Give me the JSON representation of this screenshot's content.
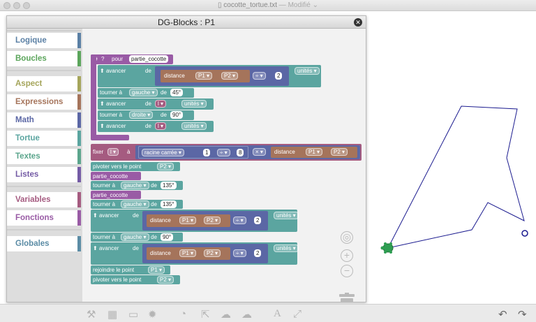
{
  "window": {
    "title": "cocotte_tortue.txt",
    "status": "— Modifié ⌄"
  },
  "panel": {
    "title": "DG-Blocks : P1",
    "close_icon": "✕"
  },
  "categories": [
    {
      "label": "Logique",
      "color": "#5b80a5",
      "bar": "#5b80a5"
    },
    {
      "label": "Boucles",
      "color": "#5ba55b",
      "bar": "#5ba55b"
    },
    {
      "label": "Aspect",
      "color": "#a5a55b",
      "bar": "#a5a55b"
    },
    {
      "label": "Expressions",
      "color": "#a5745b",
      "bar": "#a5745b"
    },
    {
      "label": "Math",
      "color": "#5b67a5",
      "bar": "#5b67a5"
    },
    {
      "label": "Tortue",
      "color": "#5ba5a0",
      "bar": "#5ba5a0"
    },
    {
      "label": "Textes",
      "color": "#5ba58c",
      "bar": "#5ba58c"
    },
    {
      "label": "Listes",
      "color": "#745ba5",
      "bar": "#745ba5"
    },
    {
      "label": "Variables",
      "color": "#a55b80",
      "bar": "#a55b80"
    },
    {
      "label": "Fonctions",
      "color": "#995ba5",
      "bar": "#995ba5"
    },
    {
      "label": "Globales",
      "color": "#5b8ca5",
      "bar": "#5b8ca5"
    }
  ],
  "blocks": {
    "fn": {
      "pour": "pour",
      "name": "partie_cocotte"
    },
    "avancer": "avancer",
    "de": "de",
    "unites": "unités",
    "distance": "distance",
    "p1": "P1",
    "p2": "P2",
    "div": "÷",
    "two": "2",
    "tourner": "tourner à",
    "gauche": "gauche",
    "droite": "droite",
    "a45": "45°",
    "a90": "90°",
    "a135": "135°",
    "l": "l",
    "fixer": "fixer",
    "a": "à",
    "racine": "racine carrée",
    "one": "1",
    "eight": "8",
    "times": "×",
    "pivoter": "pivoter vers le point",
    "call": "partie_cocotte",
    "rejoindre": "rejoindre le point"
  },
  "bottom_icons": [
    "tools-icon",
    "calculator-icon",
    "window-icon",
    "gear-icon",
    "timer-icon",
    "export-icon",
    "cloud-download-icon",
    "cloud-upload-icon",
    "text-icon",
    "arrows-icon",
    "undo-icon",
    "redo-icon"
  ],
  "colors": {
    "turtle": "#6ba5a0",
    "fn": "#995ba5",
    "var": "#a55b80",
    "math": "#5b67a5",
    "expr": "#a5745b",
    "drawing": "#1b1b8f"
  }
}
